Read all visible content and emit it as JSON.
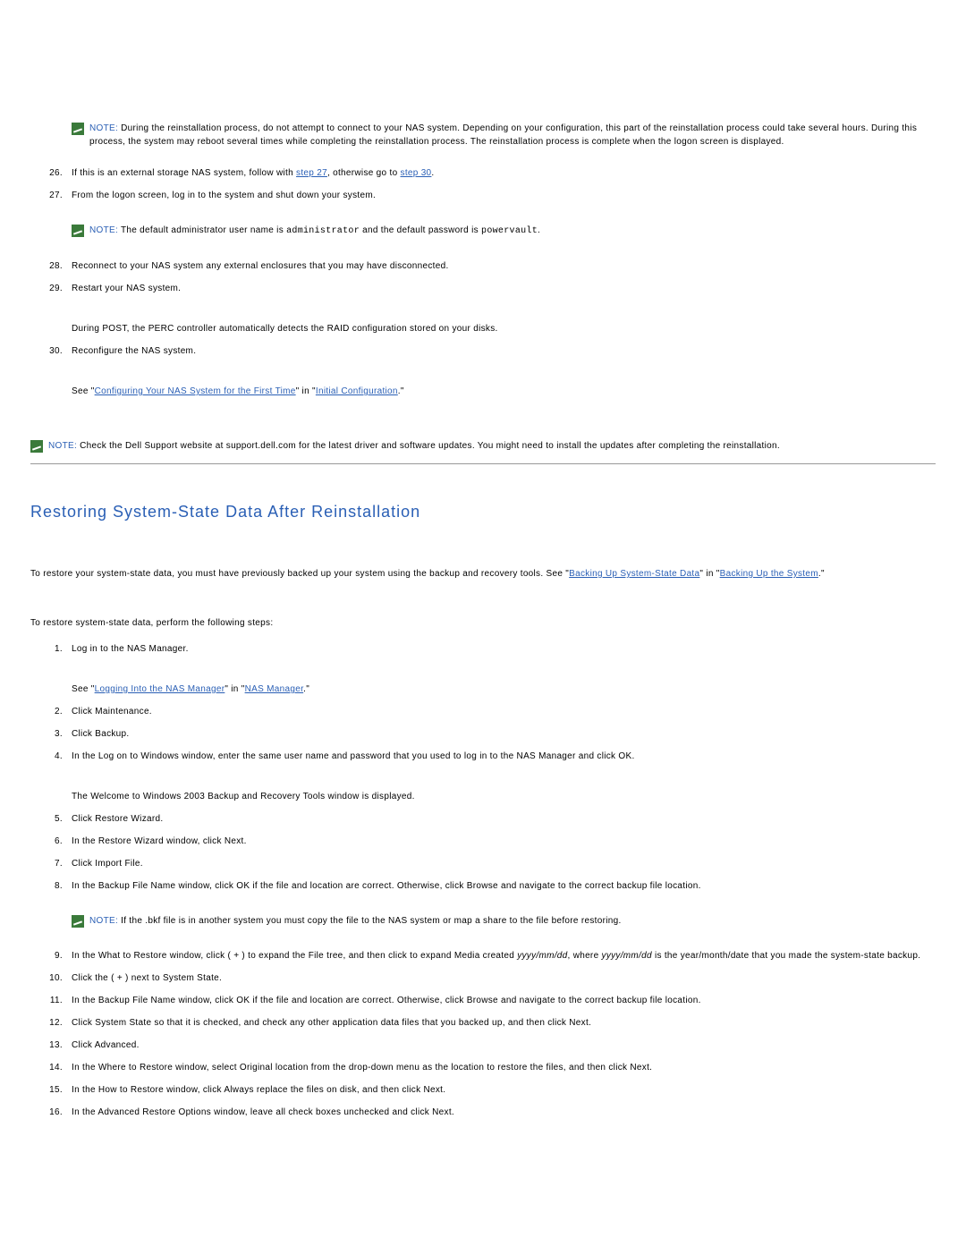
{
  "notes": {
    "label": "NOTE:",
    "n1": "During the reinstallation process, do not attempt to connect to your NAS system. Depending on your configuration, this part of the reinstallation process could take several hours. During this process, the system may reboot several times while completing the reinstallation process. The reinstallation process is complete when the logon screen is displayed.",
    "n2a": "The default administrator user name is ",
    "n2b": " and the default password is ",
    "n2c": ".",
    "n2_user": "administrator",
    "n2_pass": "powervault",
    "n3": "Check the Dell Support website at support.dell.com for the latest driver and software updates. You might need to install the updates after completing the reinstallation.",
    "n4": "If the .bkf file is in another system you must copy the file to the NAS system or map a share to the file before restoring."
  },
  "steps_a": {
    "s26_a": "If this is an external storage NAS system, follow with ",
    "s26_link1": "step 27",
    "s26_b": ", otherwise go to ",
    "s26_link2": "step 30",
    "s26_c": ".",
    "s27": "From the logon screen, log in to the system and shut down your system.",
    "s28": "Reconnect to your NAS system any external enclosures that you may have disconnected.",
    "s29": "Restart your NAS system.",
    "s29_after": "During POST, the PERC controller automatically detects the RAID configuration stored on your disks.",
    "s30": "Reconfigure the NAS system.",
    "s30_after_a": "See \"",
    "s30_link1": "Configuring Your NAS System for the First Time",
    "s30_after_b": "\" in \"",
    "s30_link2": "Initial Configuration",
    "s30_after_c": ".\""
  },
  "section_title": "Restoring System-State Data After Reinstallation",
  "intro": {
    "a": "To restore your system-state data, you must have previously backed up your system using the backup and recovery tools. See \"",
    "link1": "Backing Up System-State Data",
    "b": "\" in \"",
    "link2": "Backing Up the System",
    "c": ".\"",
    "p2": "To restore system-state data, perform the following steps:"
  },
  "steps_b": {
    "s1": "Log in to the NAS Manager.",
    "s1_after_a": "See \"",
    "s1_link1": "Logging Into the NAS Manager",
    "s1_after_b": "\" in \"",
    "s1_link2": "NAS Manager",
    "s1_after_c": ".\"",
    "s2": "Click Maintenance.",
    "s3": "Click Backup.",
    "s4": "In the Log on to Windows window, enter the same user name and password that you used to log in to the NAS Manager and click OK.",
    "s4_after": "The Welcome to Windows 2003 Backup and Recovery Tools window is displayed.",
    "s5": "Click Restore Wizard.",
    "s6": "In the Restore Wizard window, click Next.",
    "s7": "Click Import File.",
    "s8": "In the Backup File Name window, click OK if the file and location are correct. Otherwise, click Browse and navigate to the correct backup file location.",
    "s9_a": "In the What to Restore window, click ( + ) to expand the File tree, and then click to expand Media created ",
    "s9_i1": "yyyy/mm/dd",
    "s9_b": ", where ",
    "s9_i2": "yyyy/mm/dd",
    "s9_c": " is the year/month/date that you made the system-state backup.",
    "s10": "Click the ( + ) next to System State.",
    "s11": "In the Backup File Name window, click OK if the file and location are correct. Otherwise, click Browse and navigate to the correct backup file location.",
    "s12": "Click System State so that it is checked, and check any other application data files that you backed up, and then click Next.",
    "s13": "Click Advanced.",
    "s14": "In the Where to Restore window, select Original location from the drop-down menu as the location to restore the files, and then click Next.",
    "s15": "In the How to Restore window, click Always replace the files on disk, and then click Next.",
    "s16": "In the Advanced Restore Options window, leave all check boxes unchecked and click Next."
  },
  "nums": {
    "n26": "26",
    "n27": "27",
    "n28": "28",
    "n29": "29",
    "n30": "30",
    "b1": "1",
    "b2": "2",
    "b3": "3",
    "b4": "4",
    "b5": "5",
    "b6": "6",
    "b7": "7",
    "b8": "8",
    "b9": "9",
    "b10": "10",
    "b11": "11",
    "b12": "12",
    "b13": "13",
    "b14": "14",
    "b15": "15",
    "b16": "16"
  }
}
